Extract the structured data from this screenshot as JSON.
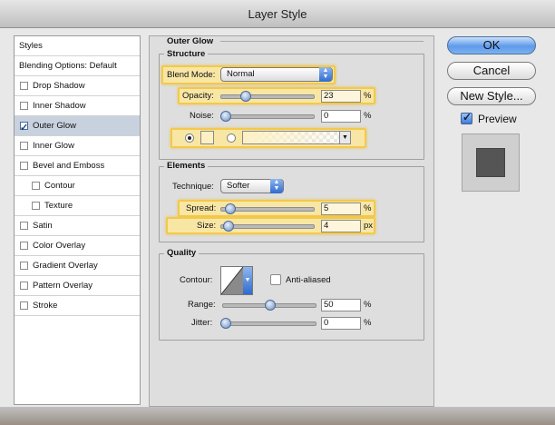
{
  "window": {
    "title": "Layer Style"
  },
  "styles_panel": {
    "items": [
      {
        "label": "Styles",
        "checkbox": false,
        "checked": false,
        "selected": false,
        "indent": 0
      },
      {
        "label": "Blending Options: Default",
        "checkbox": false,
        "checked": false,
        "selected": false,
        "indent": 0
      },
      {
        "label": "Drop Shadow",
        "checkbox": true,
        "checked": false,
        "selected": false,
        "indent": 0
      },
      {
        "label": "Inner Shadow",
        "checkbox": true,
        "checked": false,
        "selected": false,
        "indent": 0
      },
      {
        "label": "Outer Glow",
        "checkbox": true,
        "checked": true,
        "selected": true,
        "indent": 0
      },
      {
        "label": "Inner Glow",
        "checkbox": true,
        "checked": false,
        "selected": false,
        "indent": 0
      },
      {
        "label": "Bevel and Emboss",
        "checkbox": true,
        "checked": false,
        "selected": false,
        "indent": 0
      },
      {
        "label": "Contour",
        "checkbox": true,
        "checked": false,
        "selected": false,
        "indent": 1
      },
      {
        "label": "Texture",
        "checkbox": true,
        "checked": false,
        "selected": false,
        "indent": 1
      },
      {
        "label": "Satin",
        "checkbox": true,
        "checked": false,
        "selected": false,
        "indent": 0
      },
      {
        "label": "Color Overlay",
        "checkbox": true,
        "checked": false,
        "selected": false,
        "indent": 0
      },
      {
        "label": "Gradient Overlay",
        "checkbox": true,
        "checked": false,
        "selected": false,
        "indent": 0
      },
      {
        "label": "Pattern Overlay",
        "checkbox": true,
        "checked": false,
        "selected": false,
        "indent": 0
      },
      {
        "label": "Stroke",
        "checkbox": true,
        "checked": false,
        "selected": false,
        "indent": 0
      }
    ]
  },
  "outer_glow": {
    "title": "Outer Glow",
    "structure": {
      "title": "Structure",
      "blend_mode_label": "Blend Mode:",
      "blend_mode_value": "Normal",
      "opacity_label": "Opacity:",
      "opacity_value": "23",
      "opacity_unit": "%",
      "opacity_level": 0.23,
      "noise_label": "Noise:",
      "noise_value": "0",
      "noise_unit": "%",
      "noise_level": 0
    },
    "elements": {
      "title": "Elements",
      "technique_label": "Technique:",
      "technique_value": "Softer",
      "spread_label": "Spread:",
      "spread_value": "5",
      "spread_unit": "%",
      "spread_level": 0.05,
      "size_label": "Size:",
      "size_value": "4",
      "size_unit": "px",
      "size_level": 0.03
    },
    "quality": {
      "title": "Quality",
      "contour_label": "Contour:",
      "anti_aliased_label": "Anti-aliased",
      "anti_aliased_checked": false,
      "range_label": "Range:",
      "range_value": "50",
      "range_unit": "%",
      "range_level": 0.5,
      "jitter_label": "Jitter:",
      "jitter_value": "0",
      "jitter_unit": "%",
      "jitter_level": 0
    }
  },
  "buttons": {
    "ok": "OK",
    "cancel": "Cancel",
    "new_style": "New Style..."
  },
  "preview": {
    "label": "Preview",
    "checked": true
  },
  "colors": {
    "highlight": "#f3c94b",
    "accent": "#5f9ae9",
    "selected_row": "#c8d2de",
    "glow_color": "#fdf1c4"
  }
}
